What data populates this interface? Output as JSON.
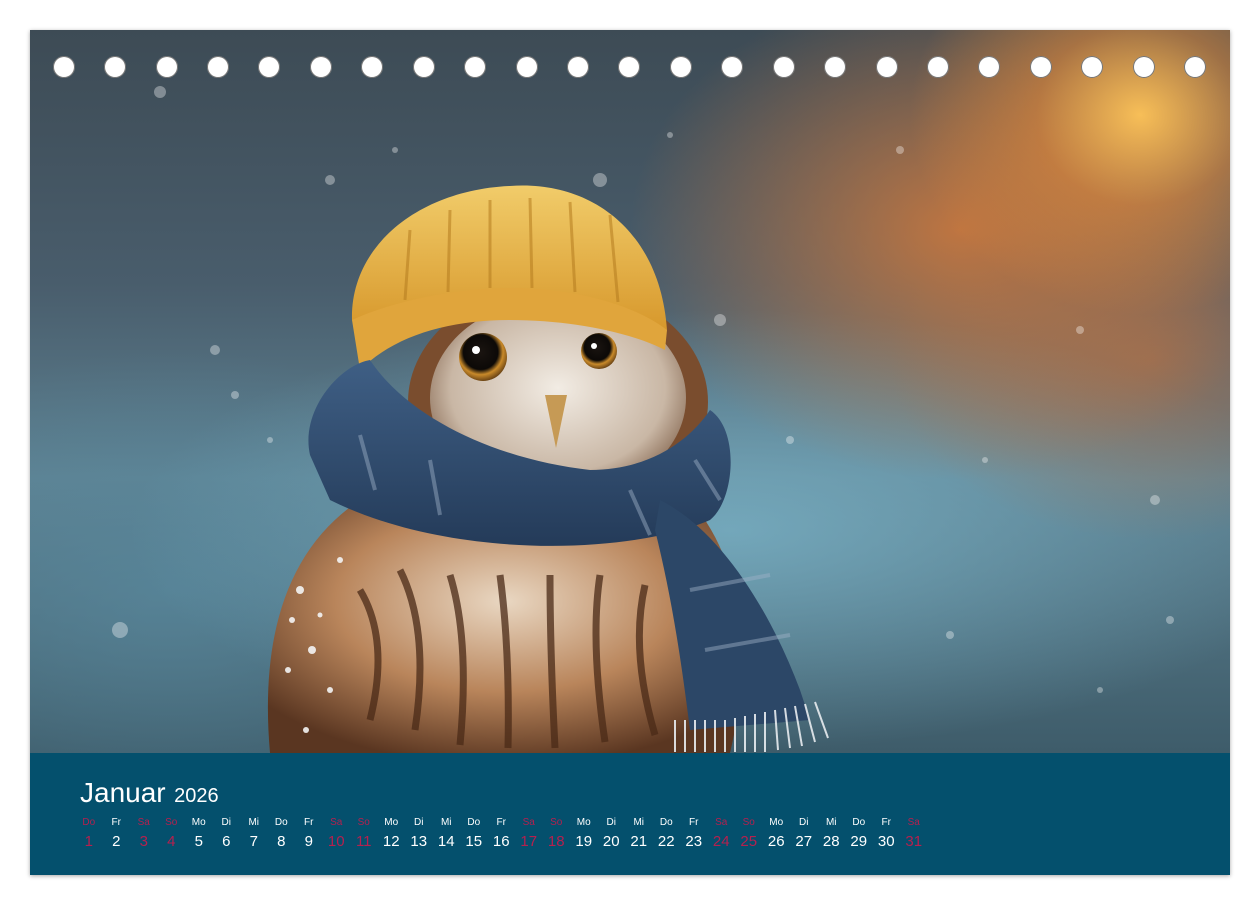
{
  "calendar": {
    "month": "Januar",
    "year": "2026",
    "weekend_color": "#b5204e",
    "band_color": "#04506d",
    "days": [
      {
        "weekday": "Do",
        "day": "1",
        "weekend": true
      },
      {
        "weekday": "Fr",
        "day": "2",
        "weekend": false
      },
      {
        "weekday": "Sa",
        "day": "3",
        "weekend": true
      },
      {
        "weekday": "So",
        "day": "4",
        "weekend": true
      },
      {
        "weekday": "Mo",
        "day": "5",
        "weekend": false
      },
      {
        "weekday": "Di",
        "day": "6",
        "weekend": false
      },
      {
        "weekday": "Mi",
        "day": "7",
        "weekend": false
      },
      {
        "weekday": "Do",
        "day": "8",
        "weekend": false
      },
      {
        "weekday": "Fr",
        "day": "9",
        "weekend": false
      },
      {
        "weekday": "Sa",
        "day": "10",
        "weekend": true
      },
      {
        "weekday": "So",
        "day": "11",
        "weekend": true
      },
      {
        "weekday": "Mo",
        "day": "12",
        "weekend": false
      },
      {
        "weekday": "Di",
        "day": "13",
        "weekend": false
      },
      {
        "weekday": "Mi",
        "day": "14",
        "weekend": false
      },
      {
        "weekday": "Do",
        "day": "15",
        "weekend": false
      },
      {
        "weekday": "Fr",
        "day": "16",
        "weekend": false
      },
      {
        "weekday": "Sa",
        "day": "17",
        "weekend": true
      },
      {
        "weekday": "So",
        "day": "18",
        "weekend": true
      },
      {
        "weekday": "Mo",
        "day": "19",
        "weekend": false
      },
      {
        "weekday": "Di",
        "day": "20",
        "weekend": false
      },
      {
        "weekday": "Mi",
        "day": "21",
        "weekend": false
      },
      {
        "weekday": "Do",
        "day": "22",
        "weekend": false
      },
      {
        "weekday": "Fr",
        "day": "23",
        "weekend": false
      },
      {
        "weekday": "Sa",
        "day": "24",
        "weekend": true
      },
      {
        "weekday": "So",
        "day": "25",
        "weekend": true
      },
      {
        "weekday": "Mo",
        "day": "26",
        "weekend": false
      },
      {
        "weekday": "Di",
        "day": "27",
        "weekend": false
      },
      {
        "weekday": "Mi",
        "day": "28",
        "weekend": false
      },
      {
        "weekday": "Do",
        "day": "29",
        "weekend": false
      },
      {
        "weekday": "Fr",
        "day": "30",
        "weekend": false
      },
      {
        "weekday": "Sa",
        "day": "31",
        "weekend": true
      }
    ]
  }
}
